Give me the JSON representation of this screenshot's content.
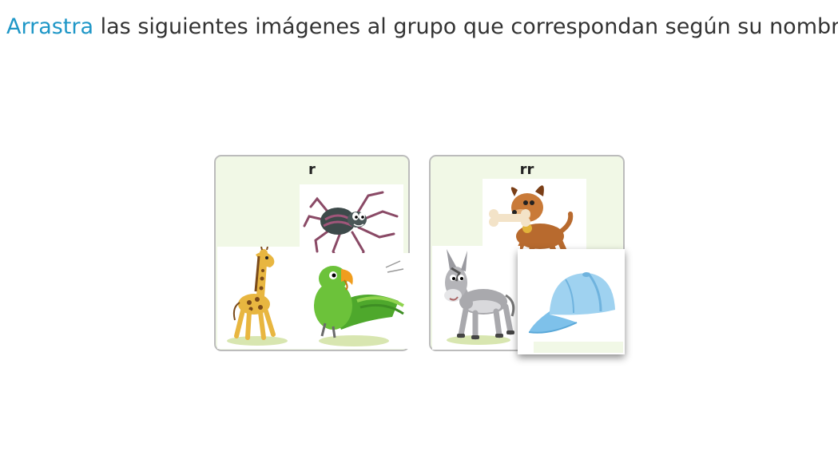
{
  "instruction": {
    "verb": "Arrastra",
    "rest": " las siguientes imágenes al grupo que correspondan según su nombre."
  },
  "colors": {
    "link_blue": "#1f97c7",
    "group_bg": "#f1f8e6",
    "group_border": "#bcbcbc"
  },
  "groups": [
    {
      "label": "r",
      "items": [
        "spider-image",
        "giraffe-image",
        "parrot-image"
      ]
    },
    {
      "label": "rr",
      "items": [
        "dog-image",
        "donkey-image",
        "cap-image"
      ]
    }
  ]
}
